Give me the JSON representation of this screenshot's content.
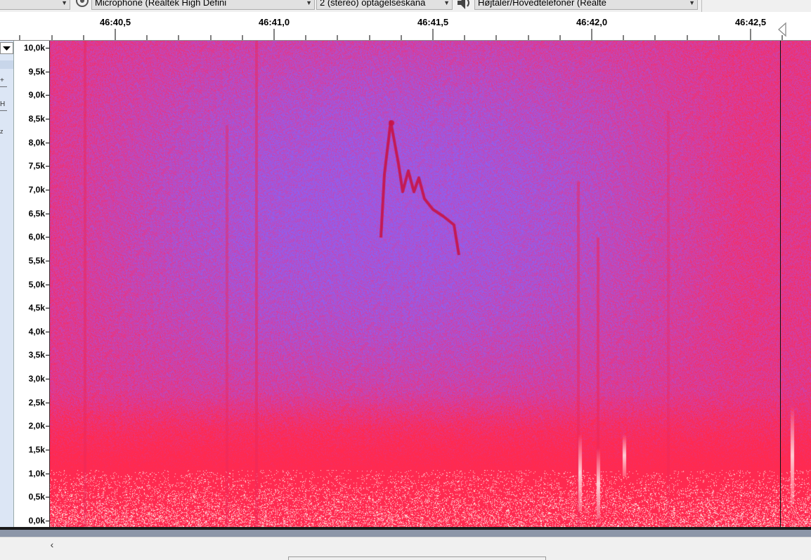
{
  "toolbar": {
    "recording_device": "Microphone (Realtek High Defini",
    "recording_channels": "2 (stereo) optagelseskana",
    "playback_device": "Højtaler/Hovedtelefoner (Realte"
  },
  "timeline": {
    "ticks": [
      {
        "label": "46:40,5",
        "value": 46.5
      },
      {
        "label": "46:41,0",
        "value": 47.0
      },
      {
        "label": "46:41,5",
        "value": 47.5
      },
      {
        "label": "46:42,0",
        "value": 48.0
      },
      {
        "label": "46:42,5",
        "value": 48.5
      }
    ]
  },
  "frequency_axis": {
    "unit": "Hz",
    "labels": [
      "10,0k",
      "9,5k",
      "9,0k",
      "8,5k",
      "8,0k",
      "7,5k",
      "7,0k",
      "6,5k",
      "6,0k",
      "5,5k",
      "5,0k",
      "4,5k",
      "4,0k",
      "3,5k",
      "3,0k",
      "2,5k",
      "2,0k",
      "1,5k",
      "1,0k",
      "0,5k",
      "0,0k"
    ],
    "max_khz": 10.0,
    "min_khz": 0.0
  },
  "colors": {
    "spectrum_low": "#ff2a50",
    "spectrum_mid": "#d63da0",
    "spectrum_high": "#8e60f0",
    "spectrum_peak": "#ffd8d8",
    "track_control": "#dce6f5"
  },
  "icons": {
    "menu": "dropdown-triangle",
    "mic": "microphone-icon",
    "speaker": "speaker-icon",
    "scroll_left": "‹"
  }
}
